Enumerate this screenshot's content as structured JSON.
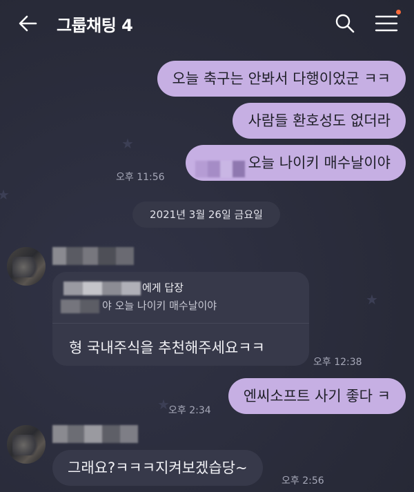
{
  "header": {
    "title": "그룹채팅 4"
  },
  "messages": {
    "m1": "오늘 축구는 안봐서 다행이었군 ㅋㅋ",
    "m2": "사람들 환호성도 없더라",
    "m3": "오늘 나이키 매수날이야",
    "t1": "오후 11:56",
    "date": "2021년 3월 26일 금요일",
    "reply_label": "에게 답장",
    "reply_quote": "야 오늘 나이키 매수날이야",
    "reply_msg": "형 국내주식을 추천해주세요ㅋㅋ",
    "t2": "오후 12:38",
    "m4": "엔씨소프트 사기 좋다 ㅋ",
    "t3": "오후 2:34",
    "m5": "그래요?ㅋㅋㅋ지켜보겠습당~",
    "t4": "오후 2:56"
  },
  "colors": {
    "background": "#2b2d3c",
    "mine_bubble": "#c6afe3",
    "their_bubble": "#37394a",
    "notification_dot": "#ff6a3a"
  },
  "icons": [
    "arrow-left-icon",
    "search-icon",
    "hamburger-menu-icon"
  ]
}
